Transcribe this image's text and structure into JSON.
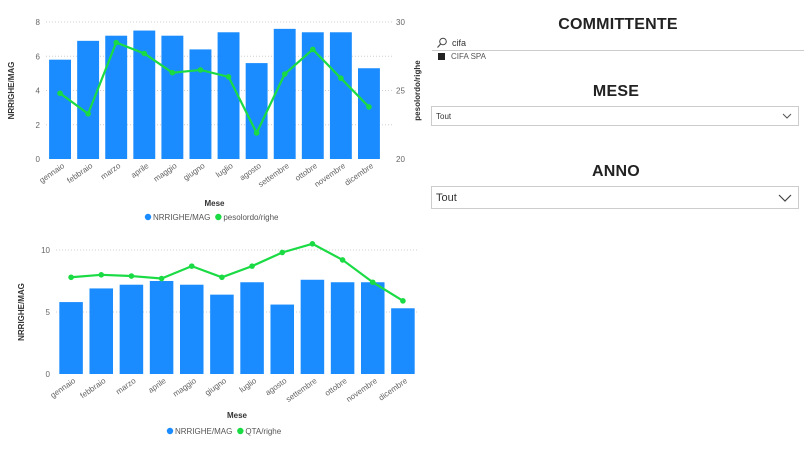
{
  "colors": {
    "bar": "#1a8cff",
    "line": "#1adb44",
    "grid": "#cfcfcf",
    "axis": "#666666"
  },
  "chart_data": [
    {
      "type": "bar",
      "title": "",
      "categories": [
        "gennaio",
        "febbraio",
        "marzo",
        "aprile",
        "maggio",
        "giugno",
        "luglio",
        "agosto",
        "settembre",
        "ottobre",
        "novembre",
        "dicembre"
      ],
      "xlabel": "Mese",
      "ylabel": "NRRIGHE/MAG",
      "y2label": "pesolordo/righe",
      "ylim": [
        0,
        8
      ],
      "yticks": [
        0,
        2,
        4,
        6,
        8
      ],
      "y2lim": [
        20,
        30
      ],
      "y2ticks": [
        20,
        25,
        30
      ],
      "grid": true,
      "legend": "bottom-center",
      "series": [
        {
          "name": "NRRIGHE/MAG",
          "kind": "bar",
          "axis": "left",
          "values": [
            5.8,
            6.9,
            7.2,
            7.5,
            7.2,
            6.4,
            7.4,
            5.6,
            7.6,
            7.4,
            7.4,
            5.3
          ]
        },
        {
          "name": "pesolordo/righe",
          "kind": "line",
          "axis": "right",
          "values": [
            24.8,
            23.3,
            28.5,
            27.7,
            26.3,
            26.5,
            26.0,
            21.9,
            26.2,
            28.0,
            25.9,
            23.8
          ]
        }
      ]
    },
    {
      "type": "bar",
      "title": "",
      "categories": [
        "gennaio",
        "febbraio",
        "marzo",
        "aprile",
        "maggio",
        "giugno",
        "luglio",
        "agosto",
        "settembre",
        "ottobre",
        "novembre",
        "dicembre"
      ],
      "xlabel": "Mese",
      "ylabel": "NRRIGHE/MAG",
      "ylim": [
        0,
        10
      ],
      "yticks": [
        0,
        5,
        10
      ],
      "grid": true,
      "legend": "bottom-center",
      "series": [
        {
          "name": "NRRIGHE/MAG",
          "kind": "bar",
          "axis": "left",
          "values": [
            5.8,
            6.9,
            7.2,
            7.5,
            7.2,
            6.4,
            7.4,
            5.6,
            7.6,
            7.4,
            7.4,
            5.3
          ]
        },
        {
          "name": "QTA/righe",
          "kind": "line",
          "axis": "left",
          "values": [
            7.8,
            8.0,
            7.9,
            7.7,
            8.7,
            7.8,
            8.7,
            9.8,
            10.5,
            9.2,
            7.4,
            5.9
          ]
        }
      ]
    }
  ],
  "slicers": {
    "committente": {
      "title": "COMMITTENTE",
      "search_value": "cifa",
      "search_icon": "search-icon",
      "items": [
        {
          "label": "CIFA SPA",
          "checked": true
        }
      ]
    },
    "mese": {
      "title": "MESE",
      "value": "Tout",
      "icon": "chevron-down-icon"
    },
    "anno": {
      "title": "ANNO",
      "value": "Tout",
      "icon": "chevron-down-icon"
    }
  }
}
